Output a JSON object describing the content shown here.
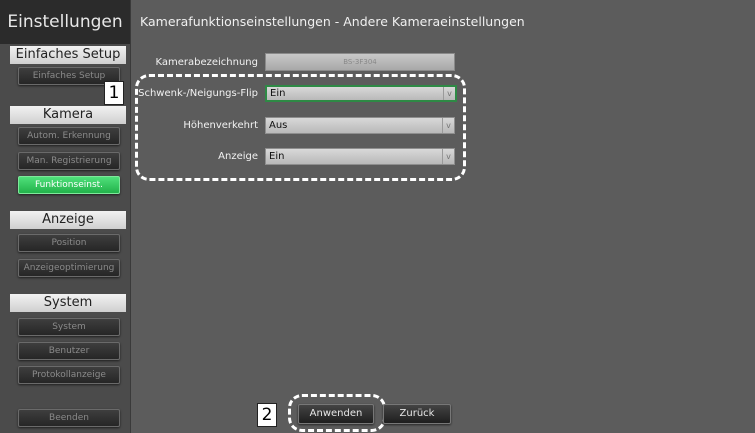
{
  "sidebar": {
    "title": "Einstellungen",
    "sections": [
      {
        "label": "Einfaches Setup",
        "items": [
          {
            "label": "Einfaches Setup",
            "active": false
          }
        ]
      },
      {
        "label": "Kamera",
        "items": [
          {
            "label": "Autom. Erkennung",
            "active": false
          },
          {
            "label": "Man. Registrierung",
            "active": false
          },
          {
            "label": "Funktionseinst.",
            "active": true
          }
        ]
      },
      {
        "label": "Anzeige",
        "items": [
          {
            "label": "Position",
            "active": false
          },
          {
            "label": "Anzeigeoptimierung",
            "active": false
          }
        ]
      },
      {
        "label": "System",
        "items": [
          {
            "label": "System",
            "active": false
          },
          {
            "label": "Benutzer",
            "active": false
          },
          {
            "label": "Protokollanzeige",
            "active": false
          }
        ]
      }
    ],
    "exit_label": "Beenden"
  },
  "main": {
    "title": "Kamerafunktionseinstellungen - Andere Kameraeinstellungen",
    "camera_name": {
      "label": "Kamerabezeichnung",
      "value": "BS-3F304"
    },
    "pan_tilt_flip": {
      "label": "Schwenk-/Neigungs-Flip",
      "value": "Ein"
    },
    "height_inverted": {
      "label": "Höhenverkehrt",
      "value": "Aus"
    },
    "display": {
      "label": "Anzeige",
      "value": "Ein"
    },
    "apply_label": "Anwenden",
    "back_label": "Zurück"
  },
  "callouts": {
    "one": "1",
    "two": "2"
  },
  "colors": {
    "accent_active": "#2fc456",
    "focus_border": "#2e8a45",
    "background": "#5c5c5c"
  }
}
